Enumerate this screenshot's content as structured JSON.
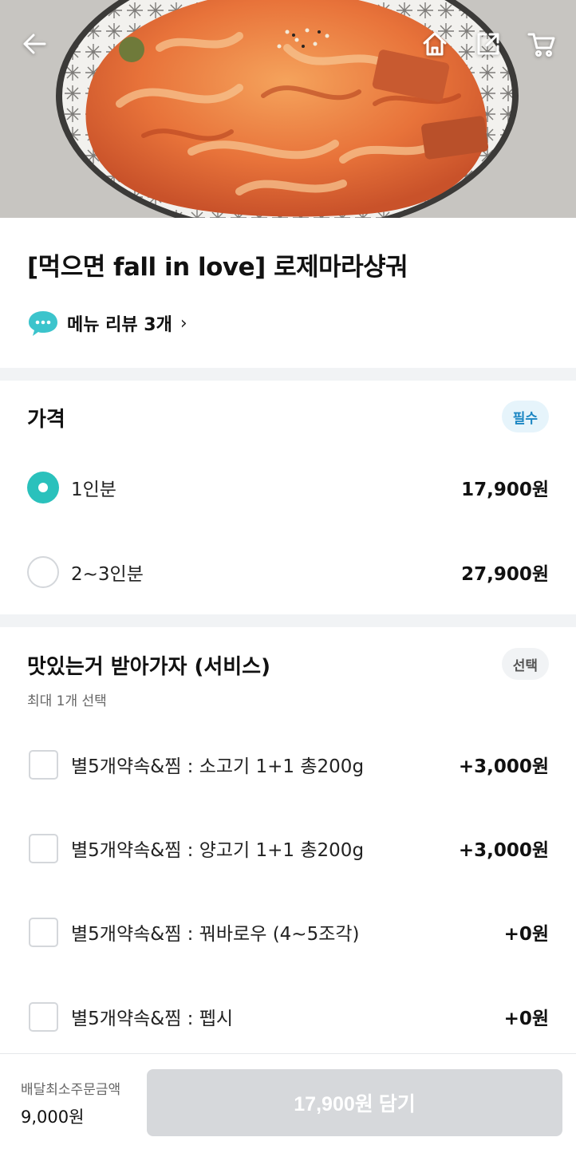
{
  "header": {
    "icons": {
      "back": "arrow-left-icon",
      "home": "home-icon",
      "share": "share-icon",
      "cart": "cart-icon"
    }
  },
  "menu": {
    "title": "[먹으면 fall in love] 로제마라샹궈",
    "review_link": "메뉴 리뷰 3개"
  },
  "price_group": {
    "title": "가격",
    "badge": "필수",
    "options": [
      {
        "label": "1인분",
        "price": "17,900원",
        "selected": true
      },
      {
        "label": "2~3인분",
        "price": "27,900원",
        "selected": false
      }
    ]
  },
  "service_group": {
    "title": "맛있는거 받아가자 (서비스)",
    "badge": "선택",
    "subtitle": "최대 1개 선택",
    "options": [
      {
        "label": "별5개약속&찜 : 소고기 1+1 총200g",
        "price": "+3,000원",
        "checked": false
      },
      {
        "label": "별5개약속&찜 : 양고기 1+1 총200g",
        "price": "+3,000원",
        "checked": false
      },
      {
        "label": "별5개약속&찜 : 꿔바로우 (4~5조각)",
        "price": "+0원",
        "checked": false
      },
      {
        "label": "별5개약속&찜 : 펩시",
        "price": "+0원",
        "checked": false
      }
    ]
  },
  "bottom_bar": {
    "min_order_label": "배달최소주문금액",
    "min_order_value": "9,000원",
    "add_button": "17,900원 담기"
  },
  "colors": {
    "accent": "#2ac1bc",
    "required_badge_bg": "#e6f4fb",
    "required_badge_text": "#1b86c3",
    "disabled_button": "#d6d8db"
  }
}
